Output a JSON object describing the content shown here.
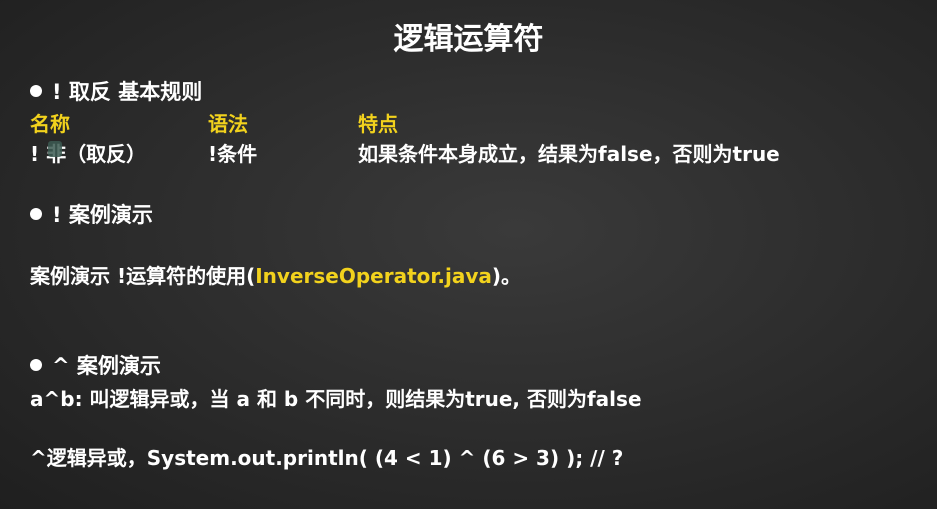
{
  "colors": {
    "accent": "#f2d21d",
    "text": "#ffffff",
    "background": "#2b2b2b"
  },
  "title": "逻辑运算符",
  "section1": {
    "heading": "! 取反 基本规则",
    "table": {
      "headers": {
        "name": "名称",
        "syntax": "语法",
        "feature": "特点"
      },
      "row": {
        "name": "! 非（取反）",
        "syntax": "!条件",
        "feature": "如果条件本身成立，结果为false，否则为true"
      }
    }
  },
  "section2": {
    "heading": "! 案例演示",
    "line_prefix": "案例演示  !运算符的使用(",
    "line_file": "InverseOperator.java",
    "line_suffix": ")。"
  },
  "section3": {
    "heading": "^ 案例演示",
    "line1": "a^b: 叫逻辑异或，当 a 和 b 不同时，则结果为true, 否则为false",
    "line2": "^逻辑异或，System.out.println( (4 < 1) ^ (6 > 3) ); // ?"
  }
}
